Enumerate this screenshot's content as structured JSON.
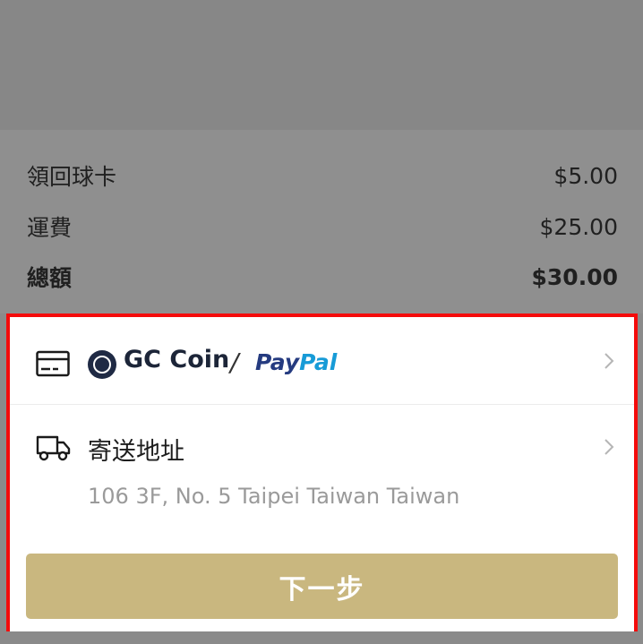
{
  "summary": {
    "card_return_label": "領回球卡",
    "card_return_value": "$5.00",
    "shipping_label": "運費",
    "shipping_value": "$25.00",
    "total_label": "總額",
    "total_value": "$30.00"
  },
  "payment": {
    "icon": "credit-card-icon",
    "coin_icon": "gc-coin-logo-icon",
    "coin_name": "GC Coin",
    "separator": "/",
    "paypal_part1": "Pay",
    "paypal_part2": "Pal"
  },
  "shipping": {
    "icon": "truck-icon",
    "label": "寄送地址",
    "address": "106 3F, No. 5 Taipei Taiwan Taiwan"
  },
  "actions": {
    "next_label": "下一步"
  },
  "colors": {
    "highlight_border": "#f40b0b",
    "button_bg": "#c9b77f",
    "overlay": "#8a8a8a",
    "paypal_dark": "#253b80",
    "paypal_light": "#179bd7"
  }
}
